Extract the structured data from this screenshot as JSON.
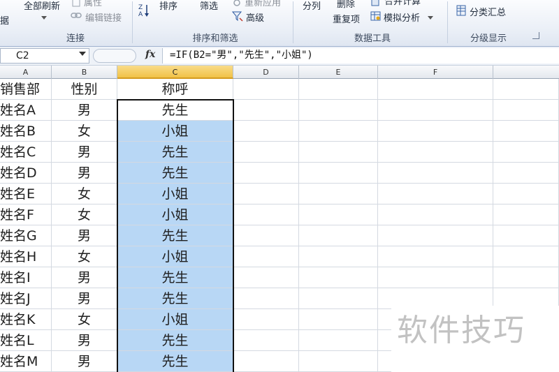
{
  "ribbon": {
    "labels": {
      "get_data": "据",
      "refresh_all": "全部刷新",
      "properties": "属性",
      "edit_links": "编辑链接",
      "sort": "排序",
      "filter": "筛选",
      "reapply": "重新应用",
      "advanced": "高级",
      "text_to_columns": "分列",
      "remove_duplicates_1": "删除",
      "remove_duplicates_2": "重复项",
      "consolidate": "合并计算",
      "what_if": "模拟分析",
      "subtotal": "分类汇总"
    },
    "groups": {
      "connections": "连接",
      "sort_filter": "排序和筛选",
      "data_tools": "数据工具",
      "outline": "分级显示"
    }
  },
  "formula_bar": {
    "name_box": "C2",
    "formula": "=IF(B2=\"男\",\"先生\",\"小姐\")"
  },
  "columns": [
    "A",
    "B",
    "C",
    "D",
    "E",
    "F"
  ],
  "header_row": {
    "a": "销售部",
    "b": "性别",
    "c": "称呼"
  },
  "rows": [
    {
      "a": "姓名A",
      "b": "男",
      "c": "先生"
    },
    {
      "a": "姓名B",
      "b": "女",
      "c": "小姐"
    },
    {
      "a": "姓名C",
      "b": "男",
      "c": "先生"
    },
    {
      "a": "姓名D",
      "b": "男",
      "c": "先生"
    },
    {
      "a": "姓名E",
      "b": "女",
      "c": "小姐"
    },
    {
      "a": "姓名F",
      "b": "女",
      "c": "小姐"
    },
    {
      "a": "姓名G",
      "b": "男",
      "c": "先生"
    },
    {
      "a": "姓名H",
      "b": "女",
      "c": "小姐"
    },
    {
      "a": "姓名I",
      "b": "男",
      "c": "先生"
    },
    {
      "a": "姓名J",
      "b": "男",
      "c": "先生"
    },
    {
      "a": "姓名K",
      "b": "女",
      "c": "小姐"
    },
    {
      "a": "姓名L",
      "b": "男",
      "c": "先生"
    },
    {
      "a": "姓名M",
      "b": "男",
      "c": "先生"
    }
  ],
  "watermark": "软件技巧",
  "colors": {
    "selection_fill": "#b8d7f5",
    "selected_header": "#f1c247",
    "active_border": "#111111"
  }
}
